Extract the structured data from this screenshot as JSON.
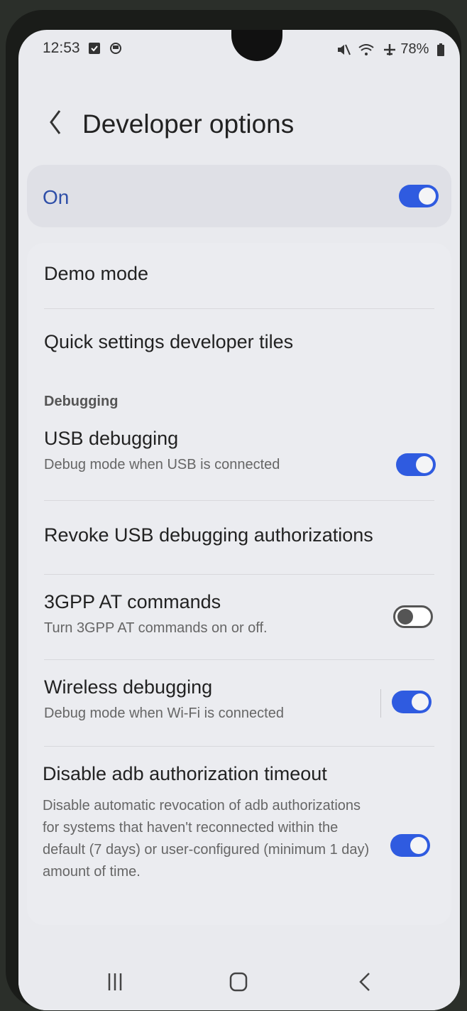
{
  "status": {
    "time": "12:53",
    "battery": "78%"
  },
  "header": {
    "title": "Developer options"
  },
  "master": {
    "label": "On",
    "enabled": true
  },
  "items": {
    "demo_mode": {
      "title": "Demo mode"
    },
    "qs_tiles": {
      "title": "Quick settings developer tiles"
    },
    "debugging_header": "Debugging",
    "usb_debugging": {
      "title": "USB debugging",
      "subtitle": "Debug mode when USB is connected",
      "enabled": true
    },
    "revoke": {
      "title": "Revoke USB debugging authorizations"
    },
    "at_commands": {
      "title": "3GPP AT commands",
      "subtitle": "Turn 3GPP AT commands on or off.",
      "enabled": false
    },
    "wireless": {
      "title": "Wireless debugging",
      "subtitle": "Debug mode when Wi-Fi is connected",
      "enabled": true
    },
    "adb_timeout": {
      "title": "Disable adb authorization timeout",
      "subtitle": "Disable automatic revocation of adb authorizations for systems that haven't reconnected within the default (7 days) or user-configured (minimum 1 day) amount of time.",
      "enabled": true
    }
  },
  "colors": {
    "accent": "#2f5be0",
    "background": "#e9eaee"
  }
}
